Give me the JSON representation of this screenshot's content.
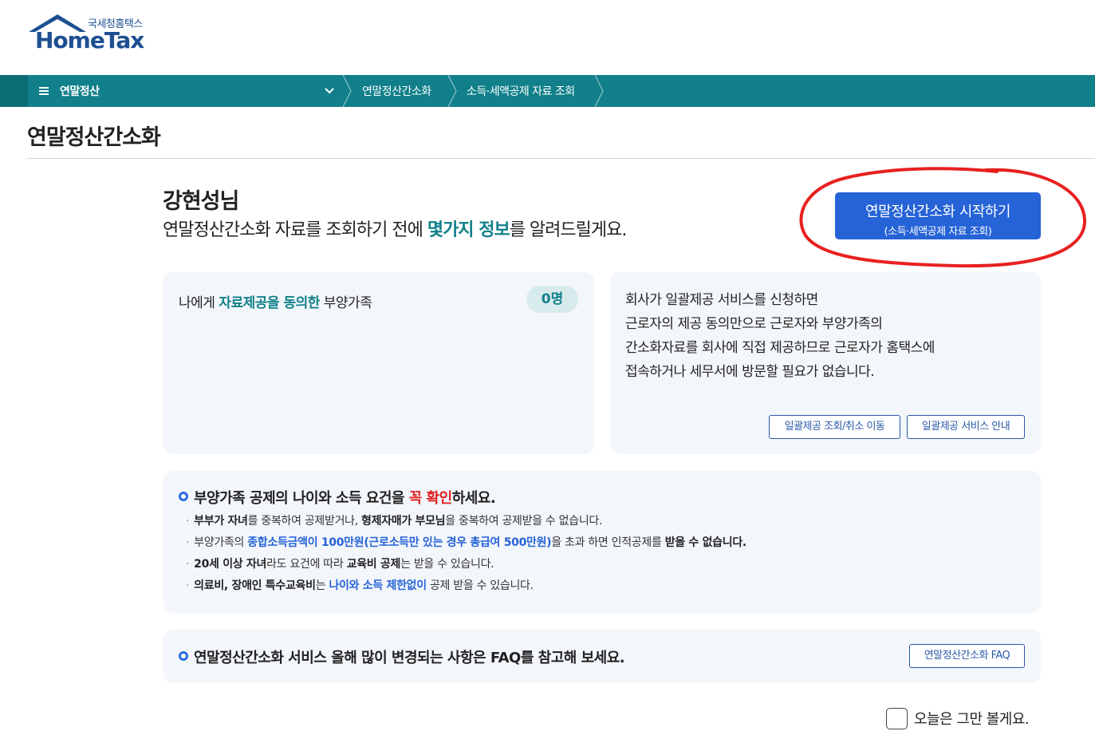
{
  "logo": {
    "sub": "국세청홈택스",
    "main": "HomeTax"
  },
  "nav": {
    "menu_label": "연말정산",
    "breadcrumbs": [
      "연말정산간소화",
      "소득·세액공제 자료 조회"
    ]
  },
  "page": {
    "title": "연말정산간소화"
  },
  "greeting": {
    "name": "강현성님",
    "line_before": "연말정산간소화 자료를 조회하기 전에 ",
    "line_highlight": "몇가지 정보",
    "line_after": "를 알려드릴게요."
  },
  "start_button": {
    "line1": "연말정산간소화 시작하기",
    "line2": "(소득·세액공제 자료 조회)"
  },
  "consent_card": {
    "label_before": "나에게 ",
    "label_highlight": "자료제공을 동의한",
    "label_after": " 부양가족",
    "count": "0명"
  },
  "bulk_card": {
    "lines": [
      "회사가 일괄제공 서비스를 신청하면",
      "근로자의 제공 동의만으로 근로자와 부양가족의",
      "간소화자료를 회사에 직접 제공하므로 근로자가 홈택스에",
      "접속하거나 세무서에 방문할 필요가 없습니다."
    ],
    "button_query": "일괄제공 조회/취소 이동",
    "button_info": "일괄제공 서비스 안내"
  },
  "notice": {
    "head_before": "부양가족 공제의 나이와 소득 요건을 ",
    "head_red": "꼭 확인",
    "head_after": "하세요.",
    "item1": {
      "b1": "부부가 자녀",
      "t1": "를 중복하여 공제받거나, ",
      "b2": "형제자매가 부모님",
      "t2": "을 중복하여 공제받을 수 없습니다."
    },
    "item2": {
      "t1": "부양가족의 ",
      "blue": "종합소득금액이 100만원(근로소득만 있는 경우 총급여 500만원)",
      "t2": "을 초과 하면 인적공제를 ",
      "b1": "받을 수 없습니다."
    },
    "item3": {
      "b1": "20세 이상 자녀",
      "t1": "라도 요건에 따라 ",
      "b2": "교육비 공제",
      "t2": "는 받을 수 있습니다."
    },
    "item4": {
      "b1": "의료비, 장애인 특수교육비",
      "t1": "는 ",
      "blue": "나이와 소득 제한없이",
      "t2": " 공제 받을 수 있습니다."
    }
  },
  "faq": {
    "text": "연말정산간소화 서비스 올해 많이 변경되는 사항은 FAQ를 참고해 보세요.",
    "button": "연말정산간소화 FAQ"
  },
  "dismiss": {
    "label": "오늘은 그만 볼게요.",
    "checked": false
  },
  "colors": {
    "nav_bg": "#11808a",
    "accent_teal": "#11808a",
    "primary_blue": "#2563d6",
    "card_bg": "#f3f6fb",
    "annotation_red": "#e82020"
  }
}
